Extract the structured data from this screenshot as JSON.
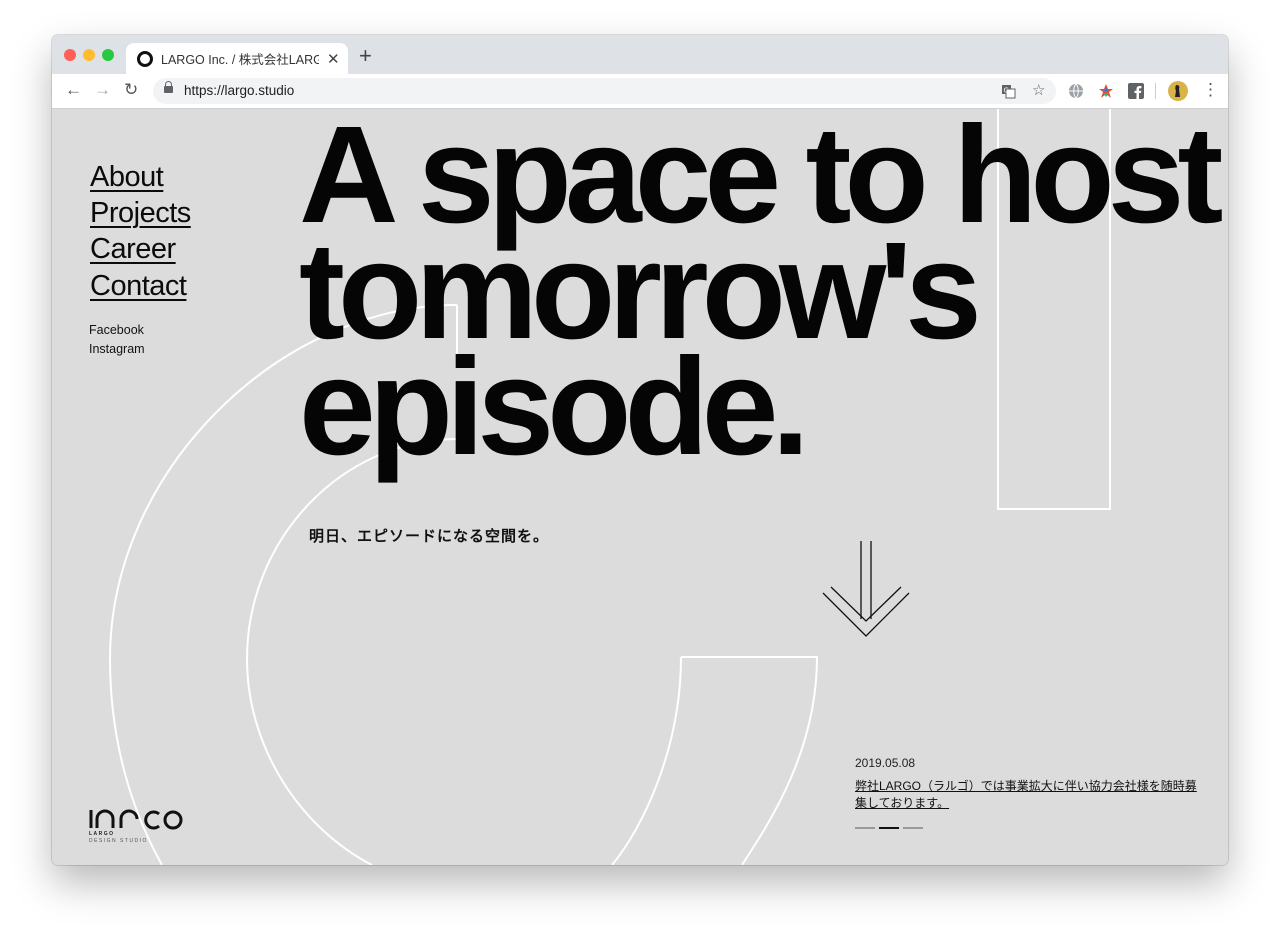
{
  "browser": {
    "tab_title": "LARGO Inc. / 株式会社LARGO",
    "tab_close": "✕",
    "new_tab": "+",
    "url": "https://largo.studio",
    "back": "←",
    "forward": "→",
    "reload": "↻",
    "translate_icon": "translate-icon",
    "bookmark_star": "☆",
    "menu_dots": "⋮",
    "traffic_lights": {
      "close": "#ff5f57",
      "minimize": "#febc2e",
      "zoom": "#28c840"
    }
  },
  "nav": {
    "items": [
      "About",
      "Projects",
      "Career",
      "Contact"
    ],
    "social": [
      "Facebook",
      "Instagram"
    ]
  },
  "hero": {
    "lines": [
      "A space to host",
      "tomorrow's",
      "episode."
    ],
    "subtitle": "明日、エピソードになる空間を。"
  },
  "news": {
    "date": "2019.05.08",
    "text": "弊社LARGO（ラルゴ）では事業拡大に伴い協力会社様を随時募集しております。",
    "pager_count": 3,
    "active_page": 2
  },
  "logo": {
    "name": "LARGO",
    "tagline": "DESIGN STUDIO"
  },
  "colors": {
    "background": "#dcdcdc",
    "text": "#050505",
    "decoration": "#ffffff"
  }
}
